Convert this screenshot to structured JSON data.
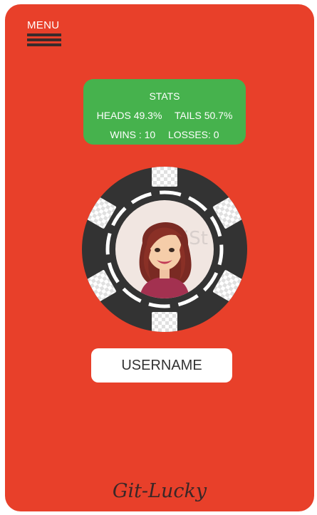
{
  "menu": {
    "label": "MENU",
    "icon": "hamburger-menu-icon"
  },
  "stats": {
    "title": "STATS",
    "heads_label": "HEADS",
    "heads_value": "49.3%",
    "tails_label": "TAILS",
    "tails_value": "50.7%",
    "wins_label": "WINS :",
    "wins_value": "10",
    "losses_label": "LOSSES:",
    "losses_value": "0"
  },
  "profile": {
    "avatar": "avatar-woman-cartoon",
    "chip_icon": "poker-chip-icon"
  },
  "username_button": {
    "label": "USERNAME"
  },
  "brand": {
    "name": "Git-Lucky"
  },
  "colors": {
    "background": "#e8402a",
    "stats_panel": "#46b24d",
    "chip_dark": "#333333",
    "text_light": "#ffffff"
  }
}
